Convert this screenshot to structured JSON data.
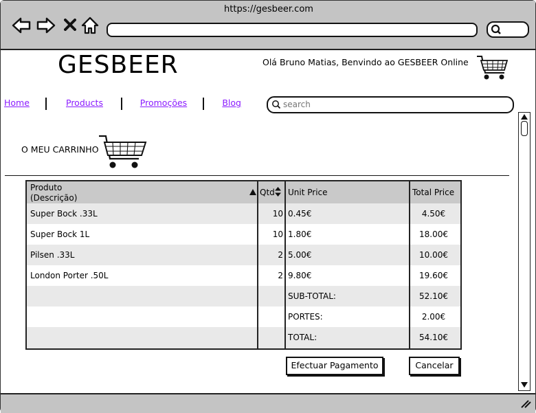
{
  "browser": {
    "url": "https://gesbeer.com",
    "address_value": "",
    "icons": [
      "back-icon",
      "forward-icon",
      "close-icon",
      "home-icon",
      "search-icon"
    ]
  },
  "header": {
    "logo": "GESBEER",
    "welcome": "Olá Bruno Matias, Benvindo ao GESBEER Online"
  },
  "nav": {
    "items": [
      {
        "label": "Home"
      },
      {
        "label": "Products"
      },
      {
        "label": "Promoções"
      },
      {
        "label": "Blog"
      }
    ],
    "search_placeholder": "search"
  },
  "section": {
    "title": "O MEU CARRINHO"
  },
  "table": {
    "headers": {
      "product_line1": "Produto",
      "product_line2": "(Descrição)",
      "qtd": "Qtd",
      "unit": "Unit Price",
      "total": "Total Price"
    },
    "rows": [
      {
        "product": "Super Bock .33L",
        "qtd": "10",
        "unit": "0.45€",
        "total": "4.50€"
      },
      {
        "product": "Super Bock 1L",
        "qtd": "10",
        "unit": "1.80€",
        "total": "18.00€"
      },
      {
        "product": "Pilsen .33L",
        "qtd": "2",
        "unit": "5.00€",
        "total": "10.00€"
      },
      {
        "product": "London Porter .50L",
        "qtd": "2",
        "unit": "9.80€",
        "total": "19.60€"
      }
    ],
    "summary": [
      {
        "label": "SUB-TOTAL:",
        "value": "52.10€"
      },
      {
        "label": "PORTES:",
        "value": "2.00€"
      },
      {
        "label": "TOTAL:",
        "value": "54.10€"
      }
    ]
  },
  "actions": {
    "pay": "Efectuar Pagamento",
    "cancel": "Cancelar"
  }
}
